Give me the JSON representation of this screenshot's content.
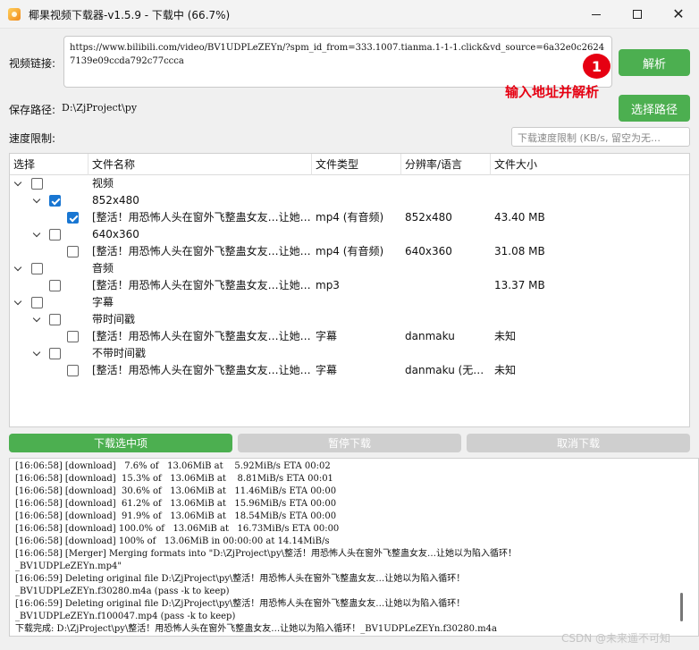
{
  "window": {
    "title": "椰果视频下载器-v1.5.9 - 下载中 (66.7%)"
  },
  "form": {
    "url_label": "视频链接:",
    "url_value": "https://www.bilibili.com/video/BV1UDPLeZEYn/?spm_id_from=333.1007.tianma.1-1-1.click&vd_source=6a32e0c26247139e09ccda792c77ccca",
    "parse_button": "解析",
    "save_label": "保存路径:",
    "save_path": "D:\\ZjProject\\py",
    "choose_path_button": "选择路径",
    "speed_label": "速度限制:",
    "speed_placeholder": "下载速度限制 (KB/s, 留空为无…"
  },
  "annotation": {
    "badge": "1",
    "text": "输入地址并解析",
    "color": "#e60012"
  },
  "table": {
    "headers": [
      "选择",
      "文件名称",
      "文件类型",
      "分辨率/语言",
      "文件大小"
    ],
    "rows": [
      {
        "level": 0,
        "expander": true,
        "checked": false,
        "name": "视频",
        "type": "",
        "res": "",
        "size": ""
      },
      {
        "level": 1,
        "expander": true,
        "checked": true,
        "name": "852x480",
        "type": "",
        "res": "",
        "size": ""
      },
      {
        "level": 2,
        "expander": false,
        "checked": true,
        "name": "[整活！用恐怖人头在窗外飞整蛊女友…让她…",
        "type": "mp4 (有音频)",
        "res": "852x480",
        "size": "43.40 MB"
      },
      {
        "level": 1,
        "expander": true,
        "checked": false,
        "name": "640x360",
        "type": "",
        "res": "",
        "size": ""
      },
      {
        "level": 2,
        "expander": false,
        "checked": false,
        "name": "[整活！用恐怖人头在窗外飞整蛊女友…让她…",
        "type": "mp4 (有音频)",
        "res": "640x360",
        "size": "31.08 MB"
      },
      {
        "level": 0,
        "expander": true,
        "checked": false,
        "name": "音频",
        "type": "",
        "res": "",
        "size": ""
      },
      {
        "level": 1,
        "expander": false,
        "checked": false,
        "name": "[整活！用恐怖人头在窗外飞整蛊女友…让她…",
        "type": "mp3",
        "res": "",
        "size": "13.37 MB"
      },
      {
        "level": 0,
        "expander": true,
        "checked": false,
        "name": "字幕",
        "type": "",
        "res": "",
        "size": ""
      },
      {
        "level": 1,
        "expander": true,
        "checked": false,
        "name": "带时间戳",
        "type": "",
        "res": "",
        "size": ""
      },
      {
        "level": 2,
        "expander": false,
        "checked": false,
        "name": "[整活！用恐怖人头在窗外飞整蛊女友…让她…",
        "type": "字幕",
        "res": "danmaku",
        "size": "未知"
      },
      {
        "level": 1,
        "expander": true,
        "checked": false,
        "name": "不带时间戳",
        "type": "",
        "res": "",
        "size": ""
      },
      {
        "level": 2,
        "expander": false,
        "checked": false,
        "name": "[整活！用恐怖人头在窗外飞整蛊女友…让她…",
        "type": "字幕",
        "res": "danmaku (无…",
        "size": "未知"
      }
    ]
  },
  "actions": {
    "download": "下载选中项",
    "pause": "暂停下载",
    "cancel": "取消下载"
  },
  "log": [
    "[16:06:58] [download]   7.6% of   13.06MiB at    5.92MiB/s ETA 00:02",
    "[16:06:58] [download]  15.3% of   13.06MiB at    8.81MiB/s ETA 00:01",
    "[16:06:58] [download]  30.6% of   13.06MiB at   11.46MiB/s ETA 00:00",
    "[16:06:58] [download]  61.2% of   13.06MiB at   15.96MiB/s ETA 00:00",
    "[16:06:58] [download]  91.9% of   13.06MiB at   18.54MiB/s ETA 00:00",
    "[16:06:58] [download] 100.0% of   13.06MiB at   16.73MiB/s ETA 00:00",
    "[16:06:58] [download] 100% of   13.06MiB in 00:00:00 at 14.14MiB/s",
    "[16:06:58] [Merger] Merging formats into \"D:\\ZjProject\\py\\整活！用恐怖人头在窗外飞整蛊女友…让她以为陷入循环！",
    "_BV1UDPLeZEYn.mp4\"",
    "[16:06:59] Deleting original file D:\\ZjProject\\py\\整活！用恐怖人头在窗外飞整蛊女友…让她以为陷入循环！",
    "_BV1UDPLeZEYn.f30280.m4a (pass -k to keep)",
    "[16:06:59] Deleting original file D:\\ZjProject\\py\\整活！用恐怖人头在窗外飞整蛊女友…让她以为陷入循环！",
    "_BV1UDPLeZEYn.f100047.mp4 (pass -k to keep)",
    "下载完成: D:\\ZjProject\\py\\整活！用恐怖人头在窗外飞整蛊女友…让她以为陷入循环！_BV1UDPLeZEYn.f30280.m4a"
  ],
  "watermark": "CSDN @未来遥不可知",
  "colors": {
    "accent_green": "#4caf50",
    "disabled_gray": "#cfcfcf",
    "checkbox_blue": "#1976d2"
  }
}
